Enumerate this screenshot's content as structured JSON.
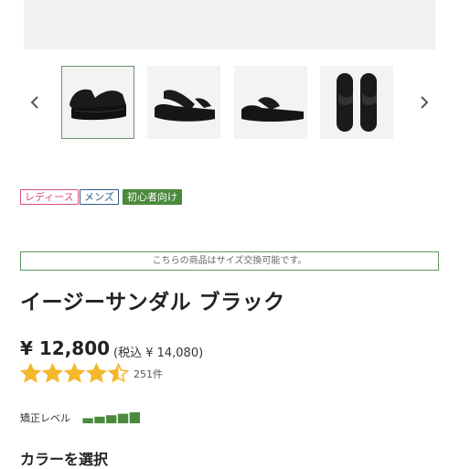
{
  "gallery": {
    "prev_icon": "chevron-left-icon",
    "next_icon": "chevron-right-icon",
    "thumbnails": [
      {
        "view": "side-angle",
        "selected": true
      },
      {
        "view": "front-angle",
        "selected": false
      },
      {
        "view": "side",
        "selected": false
      },
      {
        "view": "top",
        "selected": false
      }
    ]
  },
  "tags": {
    "ladies": "レディース",
    "mens": "メンズ",
    "beginner": "初心者向け"
  },
  "notice": "こちらの商品はサイズ交換可能です。",
  "product": {
    "title": "イージーサンダル ブラック",
    "price": "¥ 12,800",
    "tax_included": "(税込 ¥ 14,080)",
    "rating": 4.5,
    "review_count": "251件"
  },
  "correction": {
    "label": "矯正レベル",
    "level": 5,
    "max": 5
  },
  "color_section": {
    "heading": "カラーを選択"
  },
  "colors": {
    "star": "#f5b72b",
    "meter": "#4a8a3c",
    "accent_border": "#5f9a5f"
  }
}
